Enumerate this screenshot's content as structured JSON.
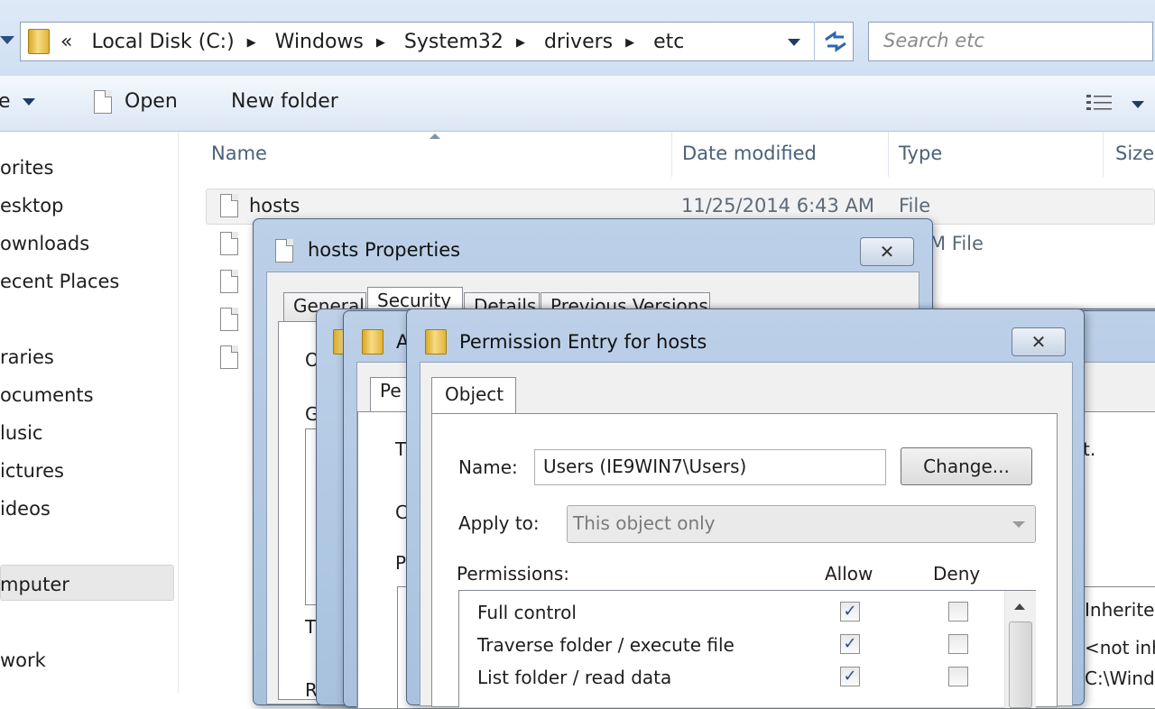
{
  "explorer": {
    "breadcrumb": [
      "Local Disk (C:)",
      "Windows",
      "System32",
      "drivers",
      "etc"
    ],
    "breadcrumb_overflow": "«",
    "search_placeholder": "Search etc",
    "toolbar": {
      "organize_partial": "e",
      "open_label": "Open",
      "new_folder_label": "New folder"
    },
    "nav_items": [
      "orites",
      "esktop",
      "ownloads",
      "ecent Places",
      "raries",
      "ocuments",
      "lusic",
      "ictures",
      "ideos",
      "mputer",
      "work"
    ],
    "columns": {
      "name": "Name",
      "date": "Date modified",
      "type": "Type",
      "size": "Size"
    },
    "files": [
      {
        "name": "hosts",
        "date": "11/25/2014 6:43 AM",
        "type": "File"
      }
    ],
    "partial_type_row2": "M File"
  },
  "properties_dialog": {
    "title": "hosts Properties",
    "tabs": [
      "General",
      "Security",
      "Details",
      "Previous Versions"
    ],
    "close_glyph": "✕",
    "partial_labels": [
      "O",
      "G",
      "T",
      "C",
      "P",
      "T",
      "R"
    ]
  },
  "advanced_dialog": {
    "title_partial": "A",
    "tab_partial": "Pe",
    "partial_text_right": "t.",
    "col_inherited": "Inherited",
    "cells": [
      "<not inh",
      "C:\\Windo"
    ],
    "partial_labels": [
      "T",
      "C",
      "P"
    ]
  },
  "permission_entry": {
    "title": "Permission Entry for hosts",
    "close_glyph": "✕",
    "tab": "Object",
    "name_label": "Name:",
    "name_value": "Users (IE9WIN7\\Users)",
    "change_button": "Change...",
    "apply_label": "Apply to:",
    "apply_value": "This object only",
    "permissions_label": "Permissions:",
    "allow_label": "Allow",
    "deny_label": "Deny",
    "permissions": [
      {
        "name": "Full control",
        "allow": true,
        "deny": false
      },
      {
        "name": "Traverse folder / execute file",
        "allow": true,
        "deny": false
      },
      {
        "name": "List folder / read data",
        "allow": true,
        "deny": false
      }
    ]
  }
}
